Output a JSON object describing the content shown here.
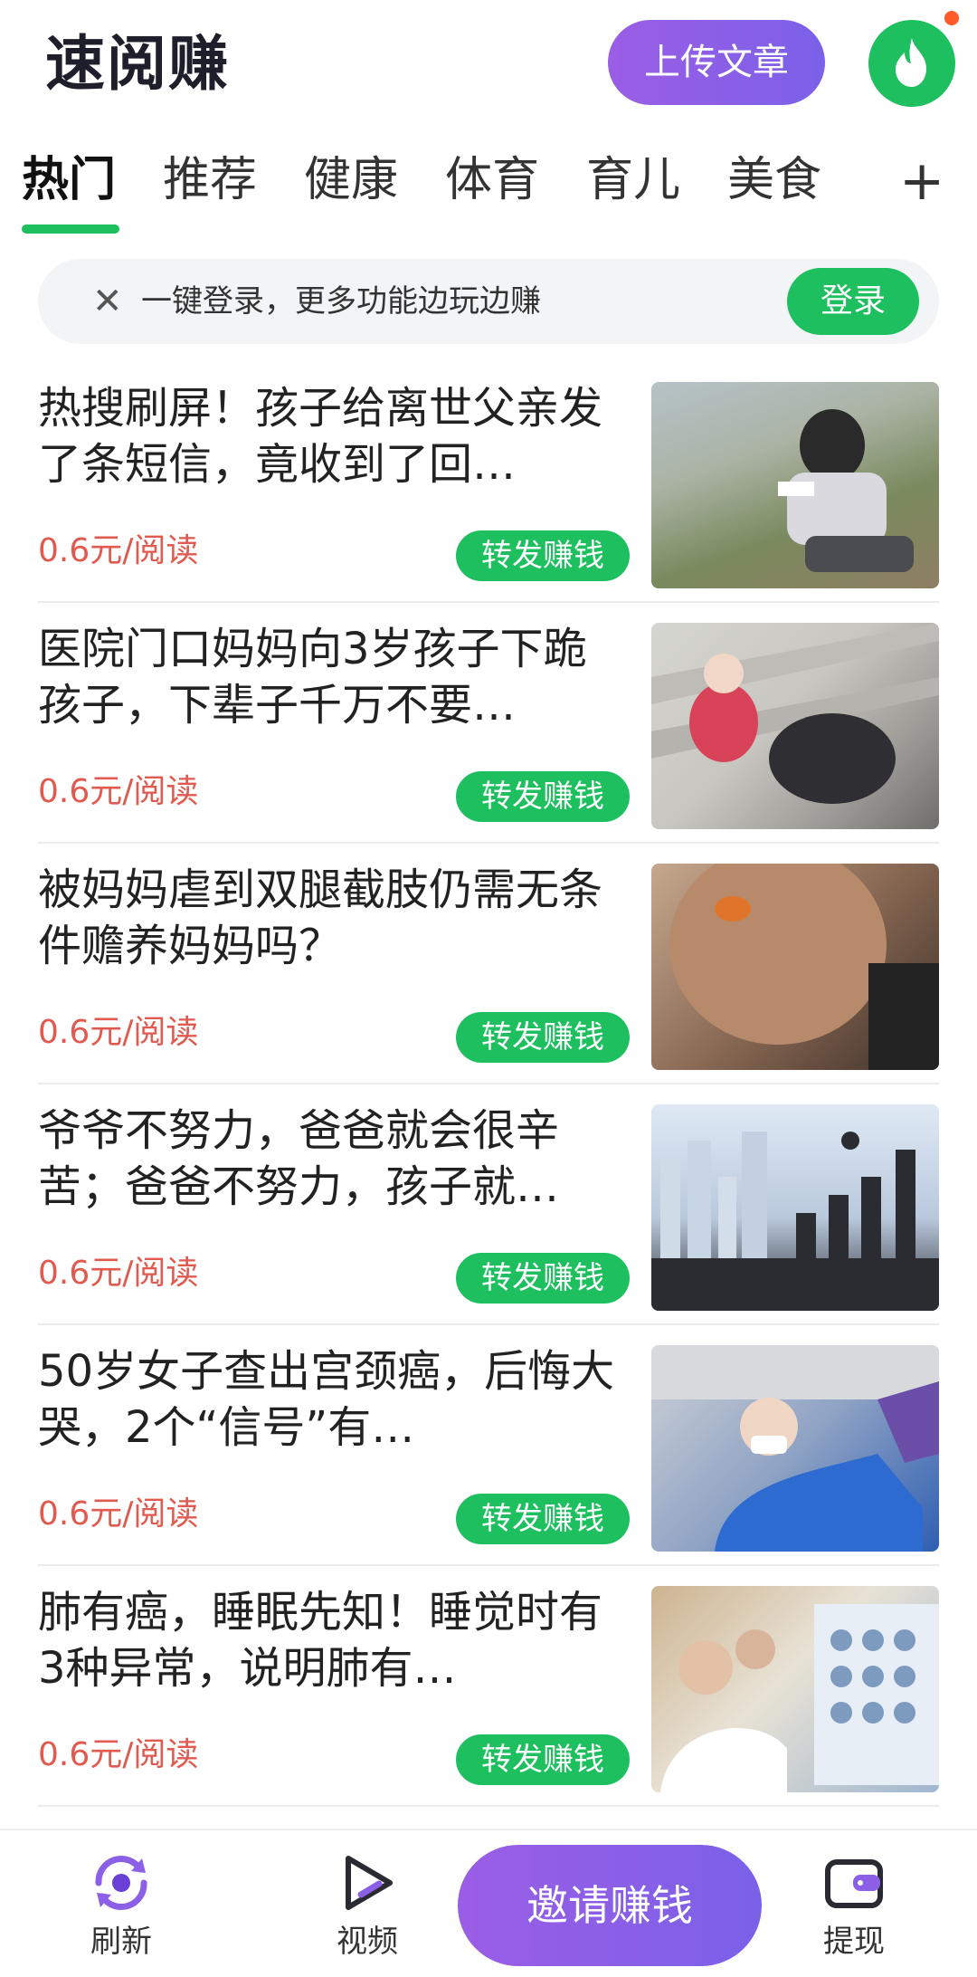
{
  "header": {
    "app_title": "速阅赚",
    "upload_label": "上传文章"
  },
  "tabs": [
    {
      "label": "热门",
      "active": true
    },
    {
      "label": "推荐"
    },
    {
      "label": "健康"
    },
    {
      "label": "体育"
    },
    {
      "label": "育儿"
    },
    {
      "label": "美食"
    }
  ],
  "tab_add": "+",
  "login_banner": {
    "text": "一键登录，更多功能边玩边赚",
    "button": "登录"
  },
  "news": [
    {
      "title": "热搜刷屏！孩子给离世父亲发了条短信，竟收到了回…",
      "price": "0.6元/阅读",
      "share": "转发赚钱"
    },
    {
      "title": "医院门口妈妈向3岁孩子下跪孩子，下辈子千万不要…",
      "price": "0.6元/阅读",
      "share": "转发赚钱"
    },
    {
      "title": "被妈妈虐到双腿截肢仍需无条件赡养妈妈吗？",
      "price": "0.6元/阅读",
      "share": "转发赚钱"
    },
    {
      "title": "爷爷不努力，爸爸就会很辛苦；爸爸不努力，孩子就…",
      "price": "0.6元/阅读",
      "share": "转发赚钱"
    },
    {
      "title": "50岁女子查出宫颈癌，后悔大哭，2个“信号”有…",
      "price": "0.6元/阅读",
      "share": "转发赚钱"
    },
    {
      "title": "肺有癌，睡眠先知！睡觉时有3种异常，说明肺有…",
      "price": "0.6元/阅读",
      "share": "转发赚钱"
    }
  ],
  "bottom_nav": {
    "refresh": "刷新",
    "video": "视频",
    "invite": "邀请赚钱",
    "withdraw": "提现"
  },
  "colors": {
    "accent_green": "#1dbf5e",
    "accent_purple": "#8b5fe6",
    "price_red": "#e05a4f"
  }
}
